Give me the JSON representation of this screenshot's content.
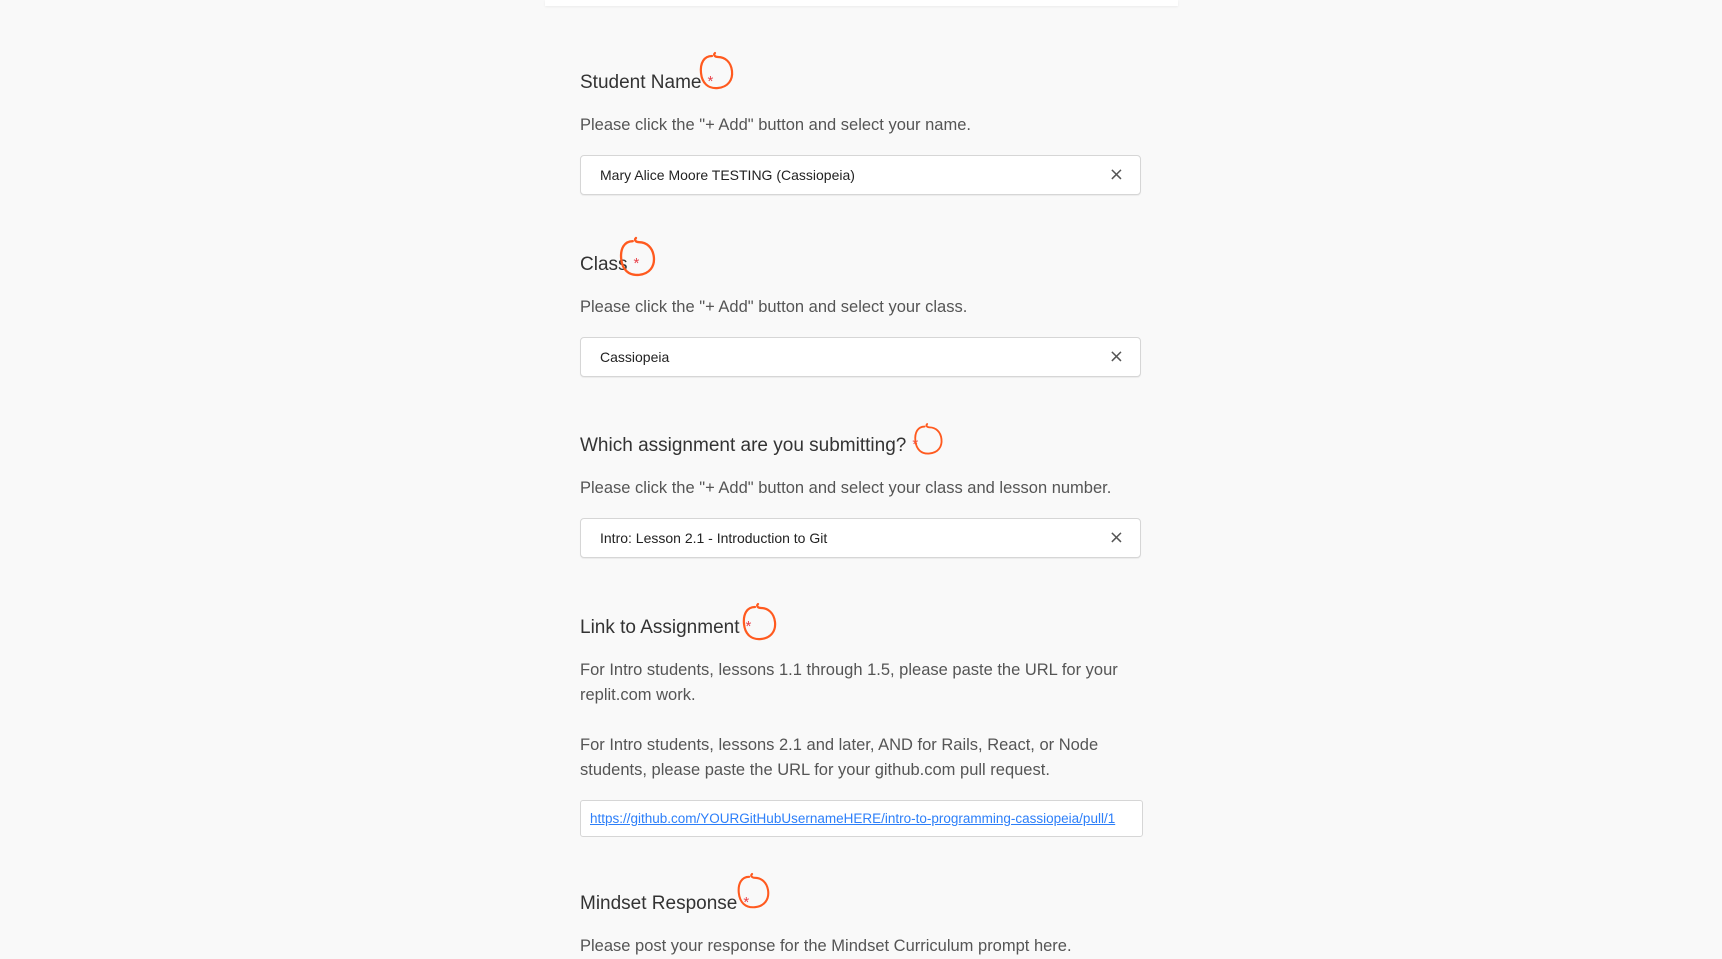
{
  "accent_color": "#e8424a",
  "annotation_color": "#ff5a1f",
  "link_color": "#2d7ff9",
  "required_marker": "*",
  "fields": {
    "student_name": {
      "label": "Student Name",
      "help": "Please click the \"+ Add\" button and select your name.",
      "value": "Mary Alice Moore TESTING (Cassiopeia)",
      "remove_icon": "×"
    },
    "class": {
      "label": "Class",
      "help": "Please click the \"+ Add\" button and select your class.",
      "value": "Cassiopeia",
      "remove_icon": "×"
    },
    "assignment": {
      "label": "Which assignment are you submitting?",
      "help": "Please click the \"+ Add\" button and select your class and lesson number.",
      "value": "Intro: Lesson 2.1 - Introduction to Git",
      "remove_icon": "×"
    },
    "link": {
      "label": "Link to Assignment",
      "help_1": "For Intro students, lessons 1.1 through 1.5, please paste the URL for your replit.com work.",
      "help_2": "For Intro students, lessons 2.1 and later, AND for Rails, React, or Node students, please paste the URL for your github.com pull request.",
      "value": "https://github.com/YOURGitHubUsernameHERE/intro-to-programming-cassiopeia/pull/1"
    },
    "mindset": {
      "label": "Mindset Response",
      "help": "Please post your response for the Mindset Curriculum prompt here."
    }
  }
}
